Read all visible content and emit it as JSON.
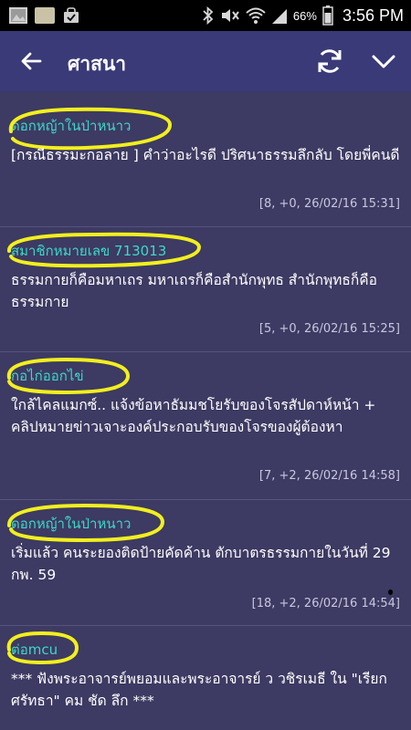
{
  "status_bar": {
    "battery_percent": "66%",
    "time": "3:56 PM",
    "icons": [
      "gallery-icon",
      "news-app-icon",
      "bag-icon",
      "bluetooth-icon",
      "mute-icon",
      "wifi-icon",
      "signal-icon",
      "battery-icon"
    ]
  },
  "app_bar": {
    "title": "ศาสนา",
    "icons": [
      "back-arrow-icon",
      "refresh-icon",
      "chevron-down-icon"
    ]
  },
  "posts": [
    {
      "author": "ดอกหญ้าในป่าหนาว",
      "body": "[กรณีธรรมะกอลาย ] คำว่าอะไรดี ปริศนาธรรมลึกลับ โดยพี่คนดี",
      "meta": "[8, +0, 26/02/16 15:31]"
    },
    {
      "author": "สมาชิกหมายเลข 713013",
      "body": "ธรรมกายก็คือมหาเถร มหาเถรก็คือสำนักพุทธ สำนักพุทธก็คือธรรมกาย",
      "meta": "[5, +0, 26/02/16 15:25]"
    },
    {
      "author": "กอไก่ออกไข่",
      "body": "ใกล้ไคลแมกซ์.. แจ้งข้อหาธัมมชโยรับของโจรสัปดาห์หน้า + คลิปหมายข่าวเจาะองค์ประกอบรับของโจรของผู้ต้องหา",
      "meta": "[7, +2, 26/02/16 14:58]"
    },
    {
      "author": "ดอกหญ้าในป่าหนาว",
      "body": "เริ่มแล้ว คนระยองติดป้ายคัดค้าน ตักบาตรธรรมกายในวันที่ 29 กพ. 59",
      "meta": "[18, +2, 26/02/16 14:54]"
    },
    {
      "author": "ต่อmcu",
      "body": "*** ฟังพระอาจารย์พยอมและพระอาจารย์ ว วชิรเมธี ใน \"เรียกศรัทธา\" คม ชัด ลึก ***",
      "meta": ""
    }
  ],
  "colors": {
    "background": "#3d3a63",
    "app_bar": "#3a3a78",
    "author": "#3cd9c6",
    "highlight": "#f2ef1e",
    "meta": "#c9c7dd"
  }
}
